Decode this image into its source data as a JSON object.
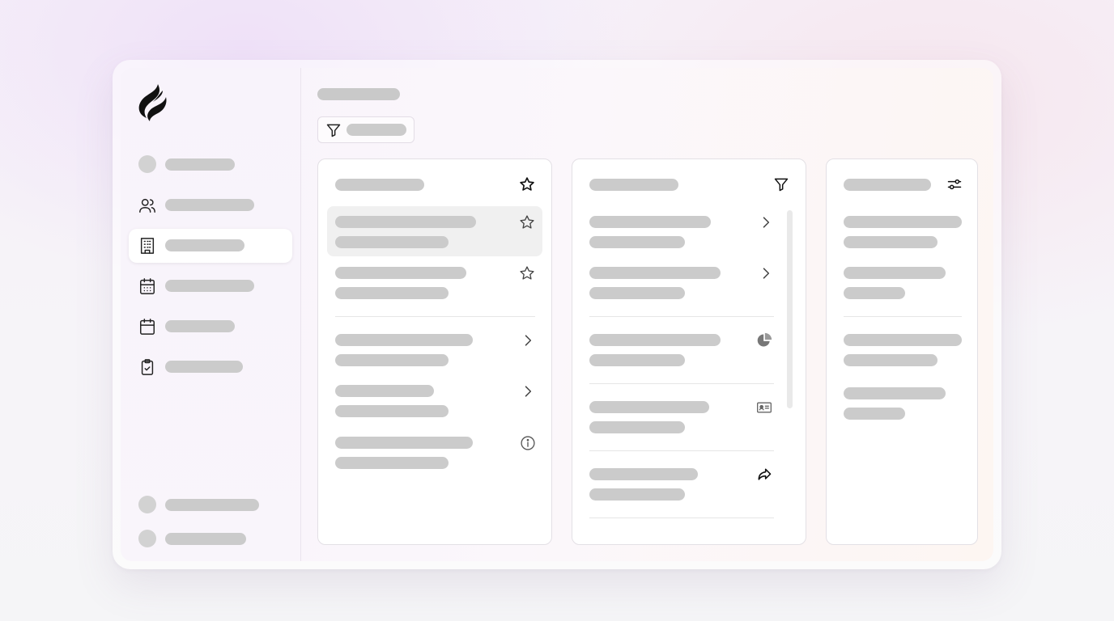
{
  "app": {
    "logo_icon": "flame-leaf-logo",
    "accent_color": "#1a1a1a",
    "skeleton_color": "#cbcbcb"
  },
  "sidebar": {
    "items": [
      {
        "icon": "circle-placeholder",
        "label": ""
      },
      {
        "icon": "users-icon",
        "label": ""
      },
      {
        "icon": "building-icon",
        "label": "",
        "active": true
      },
      {
        "icon": "calendar-grid-icon",
        "label": ""
      },
      {
        "icon": "calendar-icon",
        "label": ""
      },
      {
        "icon": "clipboard-check-icon",
        "label": ""
      }
    ],
    "footer_items": [
      {
        "icon": "circle-placeholder",
        "label": ""
      },
      {
        "icon": "circle-placeholder",
        "label": ""
      }
    ]
  },
  "main": {
    "title": "",
    "filter_label": "",
    "filter_icon": "filter-icon"
  },
  "columns": [
    {
      "title": "",
      "header_icon": "star-icon",
      "rows": [
        {
          "primary": "",
          "secondary": "",
          "icon": "star-outline-icon",
          "highlighted": true
        },
        {
          "primary": "",
          "secondary": "",
          "icon": "star-outline-icon"
        },
        {
          "primary": "",
          "secondary": "",
          "icon": "chevron-right-icon"
        },
        {
          "primary": "",
          "secondary": "",
          "icon": "chevron-right-icon"
        },
        {
          "primary": "",
          "secondary": "",
          "icon": "info-icon"
        }
      ]
    },
    {
      "title": "",
      "header_icon": "filter-icon",
      "rows": [
        {
          "primary": "",
          "secondary": "",
          "icon": "chevron-right-icon"
        },
        {
          "primary": "",
          "secondary": "",
          "icon": "chevron-right-icon"
        },
        {
          "primary": "",
          "secondary": "",
          "icon": "pie-chart-icon"
        },
        {
          "primary": "",
          "secondary": "",
          "icon": "id-card-icon"
        },
        {
          "primary": "",
          "secondary": "",
          "icon": "share-arrow-icon"
        }
      ]
    },
    {
      "title": "",
      "header_icon": "sliders-icon",
      "rows": [
        {
          "primary": "",
          "secondary": ""
        },
        {
          "primary": "",
          "secondary": ""
        },
        {
          "primary": "",
          "secondary": ""
        },
        {
          "primary": "",
          "secondary": ""
        }
      ]
    }
  ]
}
